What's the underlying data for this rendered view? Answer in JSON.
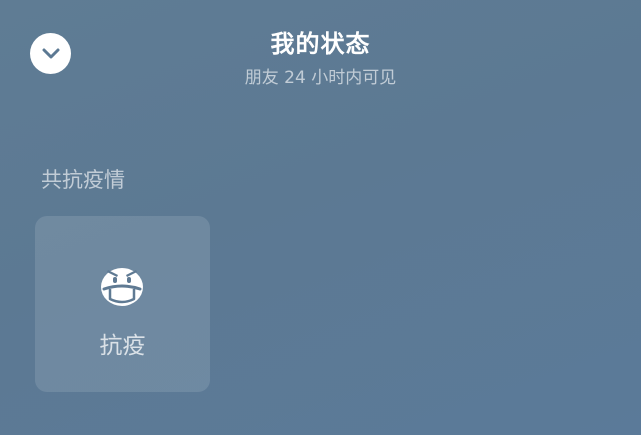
{
  "header": {
    "title": "我的状态",
    "subtitle": "朋友 24 小时内可见",
    "back_icon": "chevron-down-icon"
  },
  "section": {
    "title": "共抗疫情",
    "cards": [
      {
        "label": "抗疫",
        "icon": "mask-face-icon"
      }
    ]
  },
  "colors": {
    "background": "#5c7993",
    "card": "rgba(255,255,255,0.12)",
    "text": "#ffffff"
  }
}
